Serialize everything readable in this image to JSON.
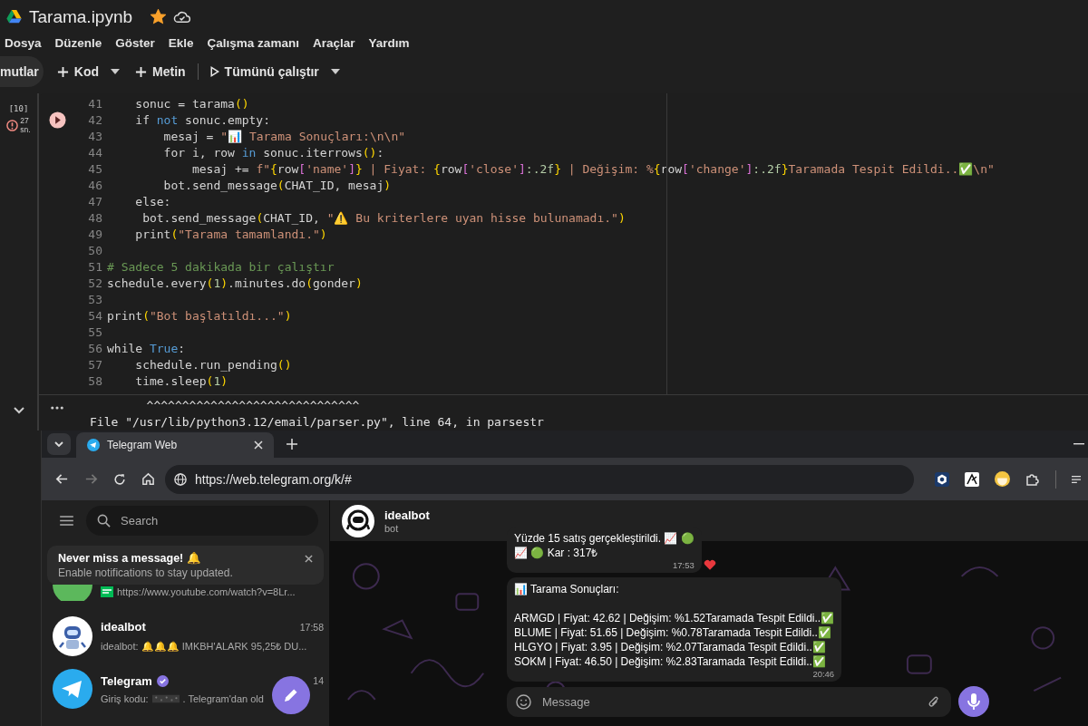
{
  "notebook": {
    "title": "Tarama.ipynb",
    "starred": true,
    "menu": [
      "Dosya",
      "Düzenle",
      "Göster",
      "Ekle",
      "Çalışma zamanı",
      "Araçlar",
      "Yardım"
    ],
    "toolbar": [
      {
        "kind": "chip",
        "label": "mutlar"
      },
      {
        "kind": "add",
        "label": "Kod"
      },
      {
        "kind": "dropdown"
      },
      {
        "kind": "add",
        "label": "Metin"
      },
      {
        "kind": "divider"
      },
      {
        "kind": "run",
        "label": "Tümünü çalıştır"
      },
      {
        "kind": "dropdown"
      }
    ]
  },
  "cell": {
    "execution_count": "[10]",
    "error": true,
    "elapsed": "27",
    "elapsed_unit": "sn.",
    "lines": [
      {
        "number": "41",
        "tokens": [
          {
            "text": "    sonuc = tarama",
            "kind": "plain"
          },
          {
            "text": "()",
            "kind": "bracket"
          }
        ]
      },
      {
        "number": "42",
        "tokens": [
          {
            "text": "    if ",
            "kind": "plain"
          },
          {
            "text": "not",
            "kind": "keyword"
          },
          {
            "text": " sonuc.empty:",
            "kind": "plain"
          }
        ]
      },
      {
        "number": "43",
        "tokens": [
          {
            "text": "        mesaj = ",
            "kind": "plain"
          },
          {
            "text": "\"📊 Tarama Sonuçları:\\n\\n\"",
            "kind": "string"
          }
        ]
      },
      {
        "number": "44",
        "tokens": [
          {
            "text": "        for i, row ",
            "kind": "plain"
          },
          {
            "text": "in",
            "kind": "keyword"
          },
          {
            "text": " sonuc.iterrows",
            "kind": "plain"
          },
          {
            "text": "()",
            "kind": "bracket"
          },
          {
            "text": ":",
            "kind": "plain"
          }
        ]
      },
      {
        "number": "45",
        "tokens": [
          {
            "text": "            mesaj += ",
            "kind": "plain"
          },
          {
            "text": "f\"",
            "kind": "string"
          },
          {
            "text": "{",
            "kind": "bracket"
          },
          {
            "text": "row",
            "kind": "plain"
          },
          {
            "text": "[",
            "kind": "index"
          },
          {
            "text": "'name'",
            "kind": "string"
          },
          {
            "text": "]",
            "kind": "index"
          },
          {
            "text": "}",
            "kind": "bracket"
          },
          {
            "text": " | Fiyat: ",
            "kind": "string"
          },
          {
            "text": "{",
            "kind": "bracket"
          },
          {
            "text": "row",
            "kind": "plain"
          },
          {
            "text": "[",
            "kind": "index"
          },
          {
            "text": "'close'",
            "kind": "string"
          },
          {
            "text": "]",
            "kind": "index"
          },
          {
            "text": ":.2f",
            "kind": "number"
          },
          {
            "text": "}",
            "kind": "bracket"
          },
          {
            "text": " | Değişim: %",
            "kind": "string"
          },
          {
            "text": "{",
            "kind": "bracket"
          },
          {
            "text": "row",
            "kind": "plain"
          },
          {
            "text": "[",
            "kind": "index"
          },
          {
            "text": "'change'",
            "kind": "string"
          },
          {
            "text": "]",
            "kind": "index"
          },
          {
            "text": ":.2f",
            "kind": "number"
          },
          {
            "text": "}",
            "kind": "bracket"
          },
          {
            "text": "Taramada Tespit Edildi..✅\\n\"",
            "kind": "string"
          }
        ]
      },
      {
        "number": "46",
        "tokens": [
          {
            "text": "        bot.send_message",
            "kind": "plain"
          },
          {
            "text": "(",
            "kind": "bracket"
          },
          {
            "text": "CHAT_ID, mesaj",
            "kind": "plain"
          },
          {
            "text": ")",
            "kind": "bracket"
          }
        ]
      },
      {
        "number": "47",
        "tokens": [
          {
            "text": "    else:",
            "kind": "plain"
          }
        ]
      },
      {
        "number": "48",
        "tokens": [
          {
            "text": "     bot.send_message",
            "kind": "plain"
          },
          {
            "text": "(",
            "kind": "bracket"
          },
          {
            "text": "CHAT_ID, ",
            "kind": "plain"
          },
          {
            "text": "\"⚠️ Bu kriterlere uyan hisse bulunamadı.\"",
            "kind": "string"
          },
          {
            "text": ")",
            "kind": "bracket"
          }
        ]
      },
      {
        "number": "49",
        "tokens": [
          {
            "text": "    print",
            "kind": "plain"
          },
          {
            "text": "(",
            "kind": "bracket"
          },
          {
            "text": "\"Tarama tamamlandı.\"",
            "kind": "string"
          },
          {
            "text": ")",
            "kind": "bracket"
          }
        ]
      },
      {
        "number": "50"
      },
      {
        "number": "51",
        "tokens": [
          {
            "text": "# Sadece 5 dakikada bir çalıştır",
            "kind": "comment"
          }
        ]
      },
      {
        "number": "52",
        "tokens": [
          {
            "text": "schedule.every",
            "kind": "plain"
          },
          {
            "text": "(",
            "kind": "bracket"
          },
          {
            "text": "1",
            "kind": "number"
          },
          {
            "text": ")",
            "kind": "bracket"
          },
          {
            "text": ".minutes.do",
            "kind": "plain"
          },
          {
            "text": "(",
            "kind": "bracket"
          },
          {
            "text": "gonder",
            "kind": "plain"
          },
          {
            "text": ")",
            "kind": "bracket"
          }
        ]
      },
      {
        "number": "53"
      },
      {
        "number": "54",
        "tokens": [
          {
            "text": "print",
            "kind": "plain"
          },
          {
            "text": "(",
            "kind": "bracket"
          },
          {
            "text": "\"Bot başlatıldı...\"",
            "kind": "string"
          },
          {
            "text": ")",
            "kind": "bracket"
          }
        ]
      },
      {
        "number": "55"
      },
      {
        "number": "56",
        "tokens": [
          {
            "text": "while ",
            "kind": "plain"
          },
          {
            "text": "True",
            "kind": "keyword"
          },
          {
            "text": ":",
            "kind": "plain"
          }
        ]
      },
      {
        "number": "57",
        "tokens": [
          {
            "text": "    schedule.run_pending",
            "kind": "plain"
          },
          {
            "text": "()",
            "kind": "bracket"
          }
        ]
      },
      {
        "number": "58",
        "tokens": [
          {
            "text": "    time.sleep",
            "kind": "plain"
          },
          {
            "text": "(",
            "kind": "bracket"
          },
          {
            "text": "1",
            "kind": "number"
          },
          {
            "text": ")",
            "kind": "bracket"
          }
        ]
      }
    ],
    "output": [
      "        ^^^^^^^^^^^^^^^^^^^^^^^^^^^^^^",
      "File \"/usr/lib/python3.12/email/parser.py\", line 64, in parsestr"
    ]
  },
  "browser": {
    "tab": {
      "title": "Telegram Web"
    },
    "url": "https://web.telegram.org/k/#"
  },
  "telegram": {
    "search": {
      "placeholder": "Search"
    },
    "notice": {
      "title": "Never miss a message! 🔔",
      "text": "Enable notifications to stay updated."
    },
    "chats": [
      {
        "kind": "partial",
        "verified": false,
        "preview": "https://www.youtube.com/watch?v=8Lr..."
      },
      {
        "kind": "bot",
        "name": "idealbot",
        "verified": false,
        "time": "17:58",
        "preview": "idealbot: 🔔🔔🔔 IMKBH'ALARK 95,25₺ DU..."
      },
      {
        "kind": "service",
        "name": "Telegram",
        "verified": true,
        "time": "14",
        "preview": "Giriş kodu:",
        "preview_rest": ". Telegram'dan old"
      }
    ],
    "chat": {
      "name": "idealbot",
      "status": "bot",
      "messages": [
        {
          "lines": [
            "Yüzde 15 satış gerçekleştirildi. 📈 🟢",
            "📈 🟢 Kar :  317₺"
          ],
          "time": "17:53",
          "reaction": true
        },
        {
          "title": "📊 Tarama Sonuçları:",
          "lines": [
            "ARMGD | Fiyat: 42.62 | Değişim: %1.52Taramada Tespit Edildi..✅",
            "BLUME | Fiyat: 51.65 | Değişim: %0.78Taramada Tespit Edildi..✅",
            "HLGYO | Fiyat: 3.95 | Değişim: %2.07Taramada Tespit Edildi..✅",
            "SOKM | Fiyat: 46.50 | Değişim: %2.83Taramada Tespit Edildi..✅"
          ],
          "time": "20:46",
          "reaction": false
        }
      ],
      "composer": {
        "placeholder": "Message"
      }
    }
  }
}
